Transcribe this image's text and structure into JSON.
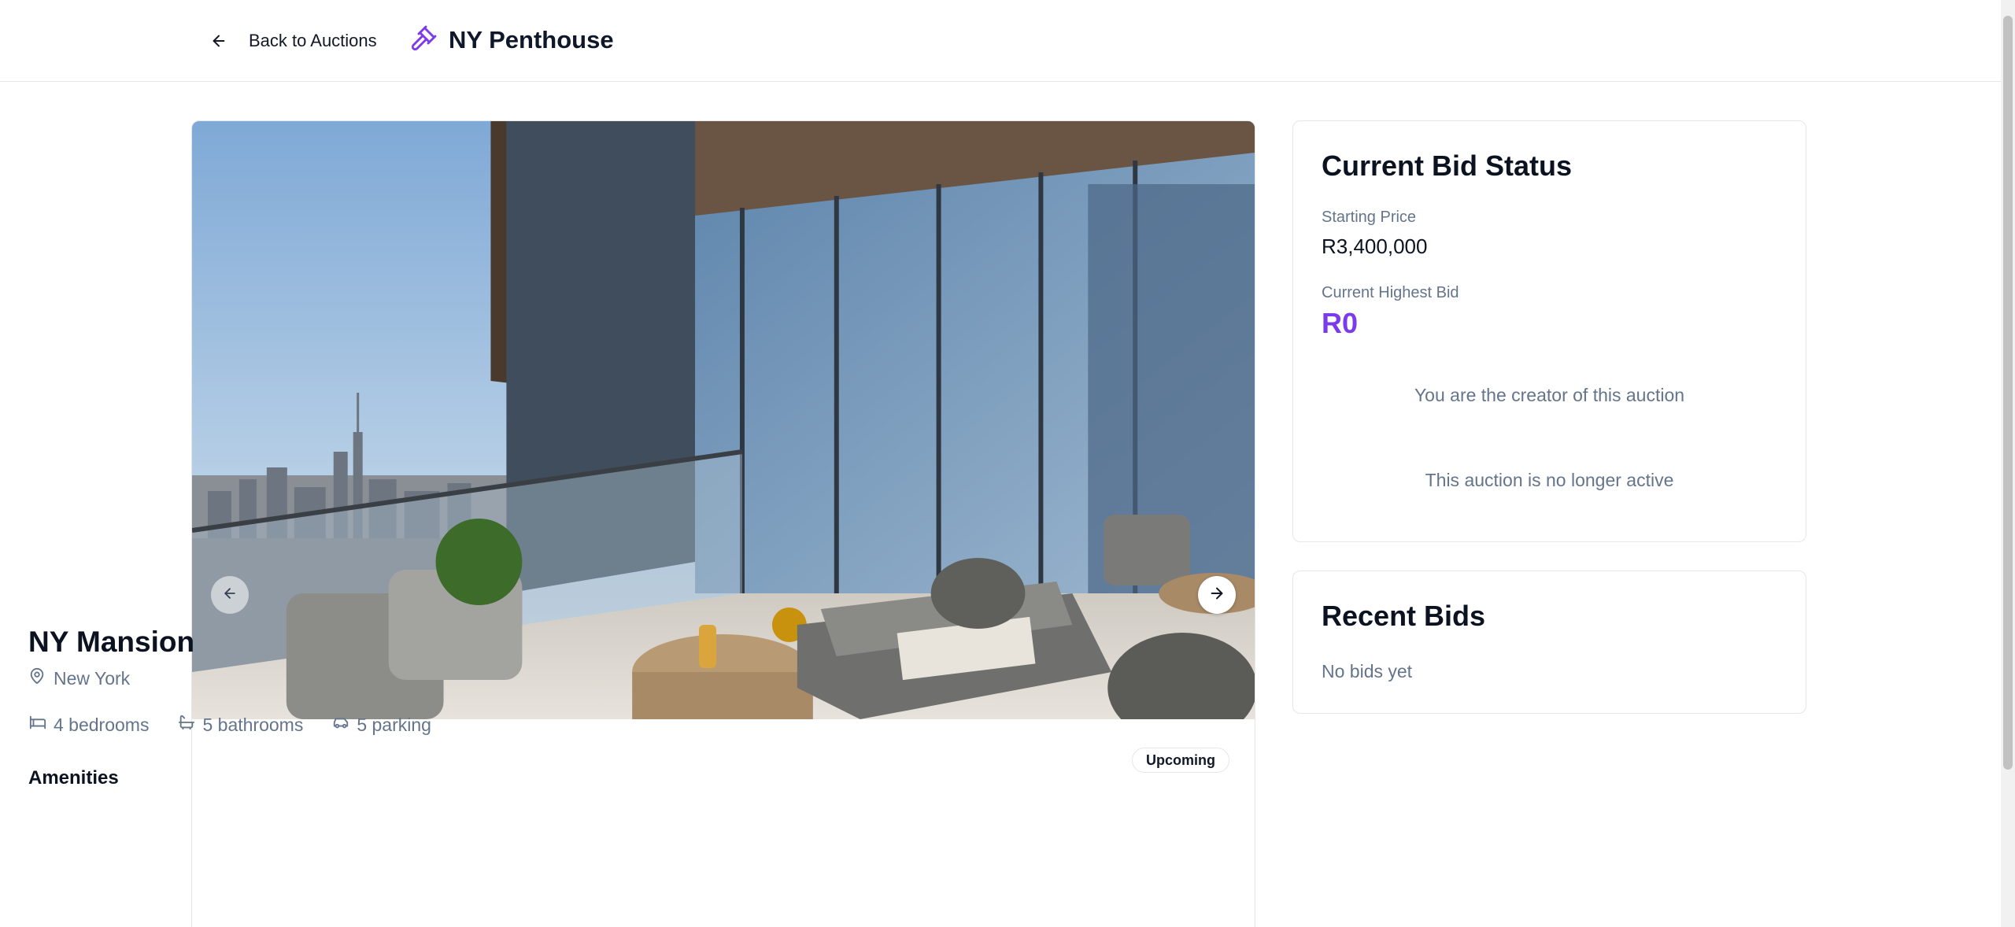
{
  "header": {
    "back_label": "Back to Auctions",
    "title": "NY Penthouse",
    "back_icon": "arrow-left-icon",
    "brand_icon": "gavel-icon",
    "accent_color": "#7c3aed"
  },
  "gallery": {
    "prev_icon": "arrow-left-icon",
    "next_icon": "arrow-right-icon"
  },
  "property": {
    "title": "NY Mansion",
    "location": "New York",
    "status": "Upcoming",
    "features": {
      "bedrooms": "4 bedrooms",
      "bathrooms": "5 bathrooms",
      "parking": "5 parking"
    },
    "amenities_heading": "Amenities"
  },
  "bid_status": {
    "title": "Current Bid Status",
    "starting_price_label": "Starting Price",
    "starting_price": "R3,400,000",
    "highest_bid_label": "Current Highest Bid",
    "highest_bid": "R0",
    "creator_message": "You are the creator of this auction",
    "inactive_message": "This auction is no longer active"
  },
  "recent_bids": {
    "title": "Recent Bids",
    "empty_message": "No bids yet"
  }
}
